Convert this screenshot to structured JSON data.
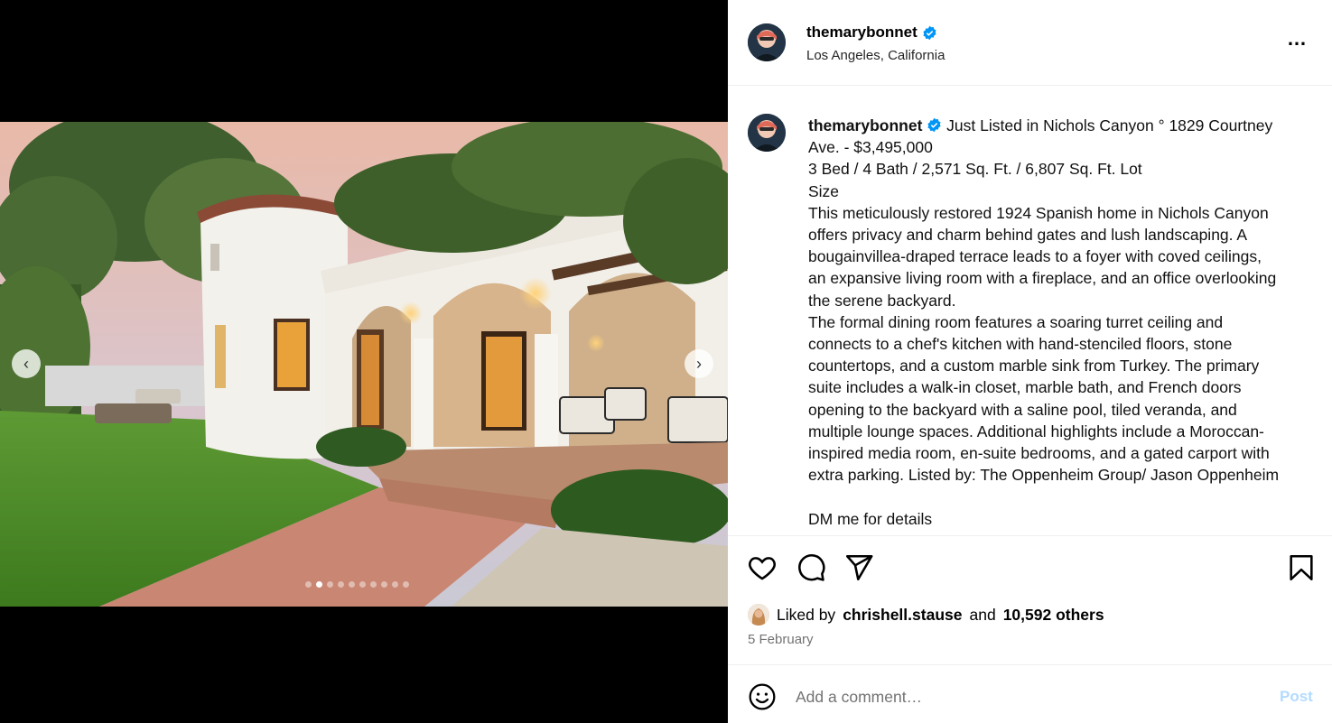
{
  "post": {
    "username": "themarybonnet",
    "location": "Los Angeles, California",
    "more_icon": "…",
    "caption_lines": [
      "Just Listed in Nichols Canyon ° 1829 Courtney",
      "Ave. - $3,495,000",
      "3 Bed / 4 Bath / 2,571 Sq. Ft. / 6,807 Sq. Ft. Lot",
      "Size",
      "This meticulously restored 1924 Spanish home in Nichols Canyon",
      "offers privacy and charm behind gates and lush landscaping. A",
      "bougainvillea-draped terrace leads to a foyer with coved ceilings,",
      "an expansive living room with a fireplace, and an office overlooking",
      "the serene backyard.",
      "The formal dining room features a soaring turret ceiling and",
      "connects to a chef's kitchen with hand-stenciled floors, stone",
      "countertops, and a custom marble sink from Turkey. The primary",
      "suite includes a walk-in closet, marble bath, and French doors",
      "opening to the backyard with a saline pool, tiled veranda, and",
      "multiple lounge spaces. Additional highlights include a Moroccan-",
      "inspired media room, en-suite bedrooms, and a gated carport with",
      "extra parking. Listed by: The Oppenheim Group/ Jason Oppenheim",
      " ",
      "DM me for details"
    ],
    "likes": {
      "prefix": "Liked by",
      "user": "chrishell.stause",
      "conj": "and",
      "others": "10,592 others"
    },
    "date": "5 February",
    "comment_placeholder": "Add a comment…",
    "post_label": "Post"
  },
  "carousel": {
    "prev_glyph": "‹",
    "next_glyph": "›",
    "slide_count": 10,
    "active_index": 1
  },
  "icons": [
    "heart-icon",
    "comment-icon",
    "share-icon",
    "bookmark-icon",
    "emoji-icon",
    "verified-badge-icon",
    "more-options-icon"
  ],
  "colors": {
    "verified": "#0095f6",
    "post_disabled": "#b3dbff",
    "secondary_text": "#737373"
  }
}
